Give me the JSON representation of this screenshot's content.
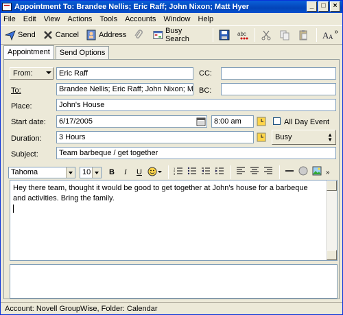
{
  "window": {
    "title": "Appointment To: Brandee Nellis; Eric Raff; John Nixon; Matt Hyer"
  },
  "window_buttons": {
    "minimize": "_",
    "maximize": "□",
    "close": "×"
  },
  "menu": [
    "File",
    "Edit",
    "View",
    "Actions",
    "Tools",
    "Accounts",
    "Window",
    "Help"
  ],
  "toolbar": {
    "send": "Send",
    "cancel": "Cancel",
    "address": "Address",
    "busy_search": "Busy Search",
    "icons": [
      "send-icon",
      "cancel-icon",
      "address-book-icon",
      "attach-icon",
      "busy-search-icon",
      "save-icon",
      "spell-check-icon",
      "cut-icon",
      "copy-icon",
      "paste-icon",
      "font-icon"
    ]
  },
  "tabs": [
    "Appointment",
    "Send Options"
  ],
  "form": {
    "from_label": "From:",
    "from_value": "Eric Raff",
    "to_label": "To:",
    "to_value": "Brandee Nellis; Eric Raff; John Nixon; Matt (...)",
    "cc_label": "CC:",
    "cc_value": "",
    "bc_label": "BC:",
    "bc_value": "",
    "place_label": "Place:",
    "place_value": "John's House",
    "start_date_label": "Start date:",
    "start_date_value": "6/17/2005",
    "start_time_value": "8:00 am",
    "all_day_label": "All Day Event",
    "duration_label": "Duration:",
    "duration_value": "3 Hours",
    "busy_value": "Busy",
    "subject_label": "Subject:",
    "subject_value": "Team barbeque / get together"
  },
  "format": {
    "font": "Tahoma",
    "size": "10",
    "bold": "B",
    "italic": "I",
    "underline": "U"
  },
  "message": {
    "body": "Hey there team, thought it would be good to get together at John's house for a barbeque and activities. Bring the family."
  },
  "status": {
    "text": "Account: Novell GroupWise,  Folder: Calendar"
  }
}
